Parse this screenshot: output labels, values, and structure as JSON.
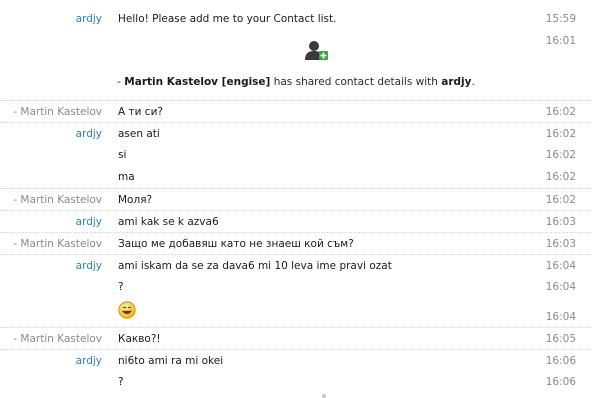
{
  "messages": [
    {
      "sender": "ardjy",
      "sender_type": "local",
      "text": "Hello! Please add me to your Contact list.",
      "time": "15:59"
    },
    {
      "sender": "",
      "sender_type": "local",
      "text": "",
      "time": "16:01"
    },
    {
      "sender": "- Martin Kastelov",
      "sender_type": "remote",
      "text": "А ти си?",
      "time": "16:02"
    },
    {
      "sender": "ardjy",
      "sender_type": "local",
      "text": "asen ati",
      "time": "16:02"
    },
    {
      "sender": "",
      "sender_type": "local",
      "text": "si",
      "time": "16:02"
    },
    {
      "sender": "",
      "sender_type": "local",
      "text": "ma",
      "time": "16:02"
    },
    {
      "sender": "- Martin Kastelov",
      "sender_type": "remote",
      "text": "Моля?",
      "time": "16:02"
    },
    {
      "sender": "ardjy",
      "sender_type": "local",
      "text": "ami kak se k azva6",
      "time": "16:03"
    },
    {
      "sender": "- Martin Kastelov",
      "sender_type": "remote",
      "text": "Защо ме добавяш като не знаеш кой съм?",
      "time": "16:03"
    },
    {
      "sender": "ardjy",
      "sender_type": "local",
      "text": "ami iskam da se za dava6 mi 10 leva ime  pravi ozat",
      "time": "16:04"
    },
    {
      "sender": "",
      "sender_type": "local",
      "text": "?",
      "time": "16:04"
    },
    {
      "sender": "",
      "sender_type": "local",
      "text": "",
      "time": "16:04",
      "emoticon": "smile"
    },
    {
      "sender": "- Martin Kastelov",
      "sender_type": "remote",
      "text": "Какво?!",
      "time": "16:05"
    },
    {
      "sender": "ardjy",
      "sender_type": "local",
      "text": "ni6to ami ra mi okei",
      "time": "16:06"
    },
    {
      "sender": "",
      "sender_type": "local",
      "text": "?",
      "time": "16:06"
    }
  ],
  "contact_share": {
    "prefix": "- ",
    "from": "Martin Kastelov [engise]",
    "middle": " has shared contact details with ",
    "to": "ardjy",
    "suffix": ".",
    "icon": "add-contact-icon"
  },
  "colors": {
    "local_sender": "#2b7fc2",
    "remote_sender": "#8a8a8a",
    "timestamp": "#8a8a8a",
    "icon_green": "#3aa63a"
  }
}
